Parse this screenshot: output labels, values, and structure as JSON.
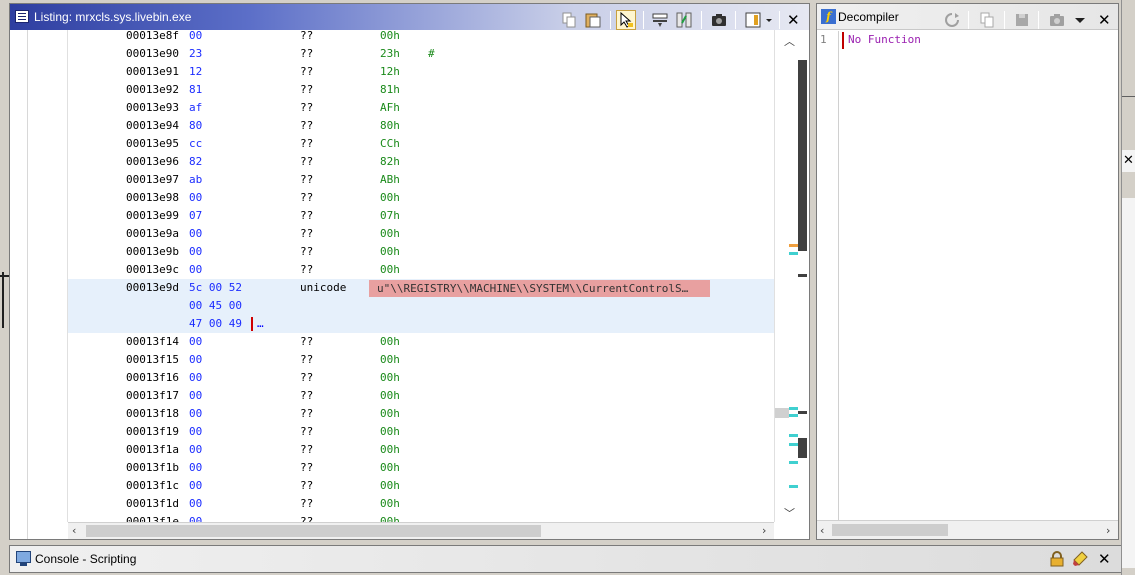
{
  "listing": {
    "title": "Listing:  mrxcls.sys.livebin.exe",
    "rows": [
      {
        "addr": "00013e8f",
        "bytes": "00",
        "mnem": "??",
        "oper": "00h",
        "cmt": ""
      },
      {
        "addr": "00013e90",
        "bytes": "23",
        "mnem": "??",
        "oper": "23h",
        "cmt": "#"
      },
      {
        "addr": "00013e91",
        "bytes": "12",
        "mnem": "??",
        "oper": "12h",
        "cmt": ""
      },
      {
        "addr": "00013e92",
        "bytes": "81",
        "mnem": "??",
        "oper": "81h",
        "cmt": ""
      },
      {
        "addr": "00013e93",
        "bytes": "af",
        "mnem": "??",
        "oper": "AFh",
        "cmt": ""
      },
      {
        "addr": "00013e94",
        "bytes": "80",
        "mnem": "??",
        "oper": "80h",
        "cmt": ""
      },
      {
        "addr": "00013e95",
        "bytes": "cc",
        "mnem": "??",
        "oper": "CCh",
        "cmt": ""
      },
      {
        "addr": "00013e96",
        "bytes": "82",
        "mnem": "??",
        "oper": "82h",
        "cmt": ""
      },
      {
        "addr": "00013e97",
        "bytes": "ab",
        "mnem": "??",
        "oper": "ABh",
        "cmt": ""
      },
      {
        "addr": "00013e98",
        "bytes": "00",
        "mnem": "??",
        "oper": "00h",
        "cmt": ""
      },
      {
        "addr": "00013e99",
        "bytes": "07",
        "mnem": "??",
        "oper": "07h",
        "cmt": ""
      },
      {
        "addr": "00013e9a",
        "bytes": "00",
        "mnem": "??",
        "oper": "00h",
        "cmt": ""
      },
      {
        "addr": "00013e9b",
        "bytes": "00",
        "mnem": "??",
        "oper": "00h",
        "cmt": ""
      },
      {
        "addr": "00013e9c",
        "bytes": "00",
        "mnem": "??",
        "oper": "00h",
        "cmt": ""
      }
    ],
    "unicode_row": {
      "addr": "00013e9d",
      "bytes_line1": "5c 00 52",
      "bytes_line2": "00 45 00",
      "bytes_line3": "47 00 49",
      "more": "…",
      "mnem": "unicode",
      "value": "u\"\\\\REGISTRY\\\\MACHINE\\\\SYSTEM\\\\CurrentControlS…"
    },
    "rows_after": [
      {
        "addr": "00013f14",
        "bytes": "00",
        "mnem": "??",
        "oper": "00h"
      },
      {
        "addr": "00013f15",
        "bytes": "00",
        "mnem": "??",
        "oper": "00h"
      },
      {
        "addr": "00013f16",
        "bytes": "00",
        "mnem": "??",
        "oper": "00h"
      },
      {
        "addr": "00013f17",
        "bytes": "00",
        "mnem": "??",
        "oper": "00h"
      },
      {
        "addr": "00013f18",
        "bytes": "00",
        "mnem": "??",
        "oper": "00h"
      },
      {
        "addr": "00013f19",
        "bytes": "00",
        "mnem": "??",
        "oper": "00h"
      },
      {
        "addr": "00013f1a",
        "bytes": "00",
        "mnem": "??",
        "oper": "00h"
      },
      {
        "addr": "00013f1b",
        "bytes": "00",
        "mnem": "??",
        "oper": "00h"
      },
      {
        "addr": "00013f1c",
        "bytes": "00",
        "mnem": "??",
        "oper": "00h"
      },
      {
        "addr": "00013f1d",
        "bytes": "00",
        "mnem": "??",
        "oper": "00h"
      },
      {
        "addr": "00013f1e",
        "bytes": "00",
        "mnem": "??",
        "oper": "00h"
      }
    ],
    "toolbar_icons": [
      "copy-icon",
      "paste-icon",
      "cursor-select-icon",
      "field-layout-icon",
      "diff-view-icon",
      "snapshot-icon",
      "column-config-icon",
      "dropdown-icon",
      "close-icon"
    ]
  },
  "decompiler": {
    "title": "Decompiler",
    "line_number": "1",
    "code": "No Function",
    "toolbar_icons": [
      "refresh-icon",
      "copy-icon",
      "export-icon",
      "snapshot-icon",
      "dropdown-icon",
      "close-icon"
    ]
  },
  "console": {
    "title": "Console - Scripting",
    "toolbar_icons": [
      "lock-icon",
      "clear-icon",
      "close-icon"
    ]
  },
  "colors": {
    "address": "#000000",
    "bytes": "#1b2cff",
    "operand": "#1a8a1a",
    "string_bg": "#e8a0a0",
    "highlight_row": "#e6f0fb",
    "decomp_text": "#9a1fb0"
  }
}
